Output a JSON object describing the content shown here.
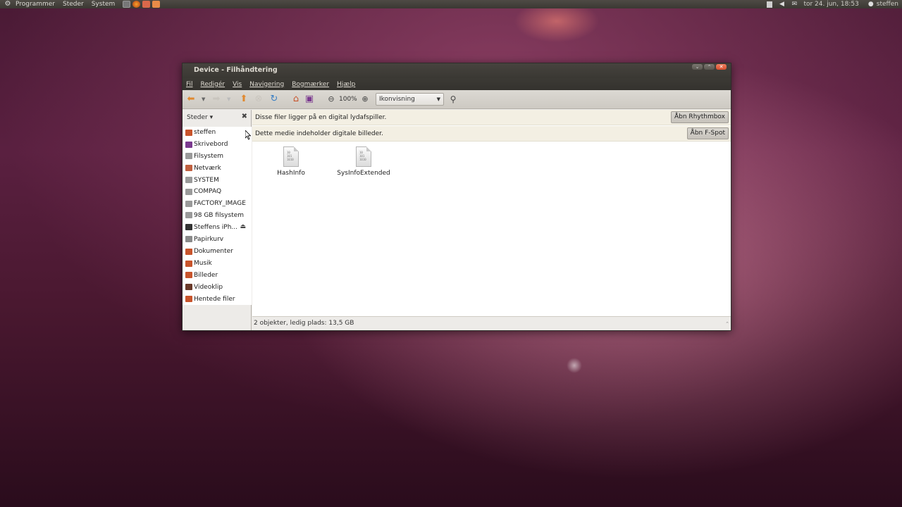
{
  "top_panel": {
    "menus": [
      "Programmer",
      "Steder",
      "System"
    ],
    "clock": "tor 24. jun, 18:53",
    "user": "steffen",
    "launcher_icons": [
      "terminal-launcher-icon",
      "firefox-launcher-icon",
      "mail-launcher-icon",
      "help-launcher-icon"
    ],
    "indicators": [
      "network-icon",
      "volume-icon",
      "mail-indicator-icon"
    ]
  },
  "window": {
    "title": "Device - Filhåndtering",
    "controls": [
      "minimize",
      "maximize",
      "close"
    ]
  },
  "menubar": {
    "items": [
      "Fil",
      "Redigér",
      "Vis",
      "Navigering",
      "Bogmærker",
      "Hjælp"
    ]
  },
  "toolbar": {
    "zoom": "100%",
    "view_mode": "Ikonvisning",
    "icons": [
      "back-icon",
      "forward-icon",
      "up-icon",
      "stop-icon",
      "reload-icon",
      "home-icon",
      "computer-icon",
      "zoom-out-icon",
      "zoom-in-icon",
      "search-icon"
    ]
  },
  "sidebar": {
    "title": "Steder",
    "items": [
      {
        "label": "steffen",
        "icon": "home-folder-icon",
        "color": "#c8542c"
      },
      {
        "label": "Skrivebord",
        "icon": "desktop-icon",
        "color": "#7b3a8f"
      },
      {
        "label": "Filsystem",
        "icon": "drive-icon",
        "color": "#9a9a9a"
      },
      {
        "label": "Netværk",
        "icon": "network-folder-icon",
        "color": "#c06040"
      },
      {
        "label": "SYSTEM",
        "icon": "drive-icon",
        "color": "#9a9a9a"
      },
      {
        "label": "COMPAQ",
        "icon": "drive-icon",
        "color": "#9a9a9a"
      },
      {
        "label": "FACTORY_IMAGE",
        "icon": "drive-icon",
        "color": "#9a9a9a"
      },
      {
        "label": "98 GB filsystem",
        "icon": "drive-icon",
        "color": "#9a9a9a"
      },
      {
        "label": "Steffens iPh...",
        "icon": "phone-icon",
        "color": "#333333",
        "eject": true
      },
      {
        "label": "Papirkurv",
        "icon": "trash-icon",
        "color": "#8a8a8a"
      },
      {
        "label": "Dokumenter",
        "icon": "documents-folder-icon",
        "color": "#c8542c"
      },
      {
        "label": "Musik",
        "icon": "music-folder-icon",
        "color": "#c8542c"
      },
      {
        "label": "Billeder",
        "icon": "pictures-folder-icon",
        "color": "#c8542c"
      },
      {
        "label": "Videoklip",
        "icon": "videos-folder-icon",
        "color": "#6a3a2a"
      },
      {
        "label": "Hentede filer",
        "icon": "downloads-folder-icon",
        "color": "#c8542c"
      }
    ]
  },
  "infobars": [
    {
      "message": "Disse filer ligger på en digital lydafspiller.",
      "button": "Åbn Rhythmbox"
    },
    {
      "message": "Dette medie indeholder digitale billeder.",
      "button": "Åbn F-Spot"
    }
  ],
  "files": [
    {
      "name": "HashInfo",
      "icon": "binary-file-icon",
      "glyph": "10\n101\n1010"
    },
    {
      "name": "SysInfoExtended",
      "icon": "binary-file-icon",
      "glyph": "10\n101\n1010"
    }
  ],
  "status": {
    "text": "2 objekter, ledig plads: 13,5 GB"
  }
}
